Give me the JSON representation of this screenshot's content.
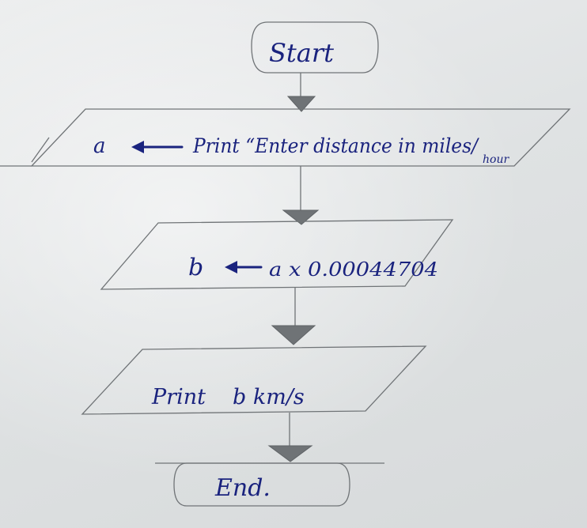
{
  "flowchart": {
    "start_label": "Start",
    "input_step": {
      "variable": "a",
      "text_main": "Print “Enter distance in miles/",
      "text_sub": "hour"
    },
    "calc_step": {
      "variable": "b",
      "expression": "a x 0.00044704"
    },
    "output_step": {
      "label": "Print",
      "text": "b km/s"
    },
    "end_label": "End."
  },
  "colors": {
    "ink": "#1a237e",
    "pencil": "#707477",
    "paper": "#e3e5e6"
  }
}
